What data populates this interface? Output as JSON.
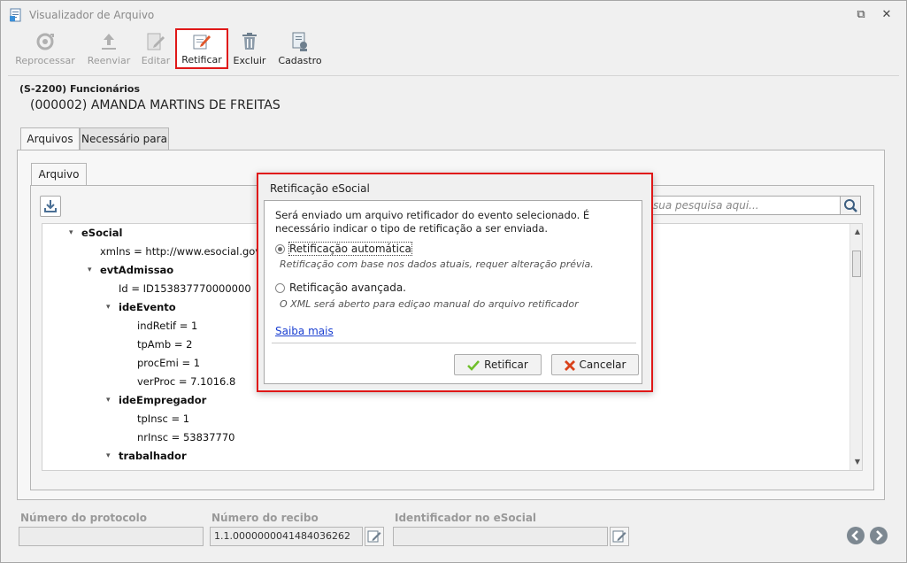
{
  "window": {
    "title": "Visualizador de Arquivo",
    "controls": {
      "restore": "⧉",
      "close": "✕"
    }
  },
  "toolbar": {
    "reprocessar": "Reprocessar",
    "reenviar": "Reenviar",
    "editar": "Editar",
    "retificar": "Retificar",
    "excluir": "Excluir",
    "cadastro": "Cadastro"
  },
  "header": {
    "event_code": "(S-2200) Funcionários",
    "employee": "(000002) AMANDA MARTINS DE FREITAS"
  },
  "tabs": {
    "arquivos": "Arquivos",
    "necessario": "Necessário para",
    "arquivo": "Arquivo"
  },
  "search": {
    "placeholder": "sua pesquisa aqui..."
  },
  "tree": [
    {
      "text": "eSocial",
      "level": 0,
      "bold": true,
      "expanded": true
    },
    {
      "text": "xmlns = http://www.esocial.gov.b",
      "level": 1,
      "bold": false
    },
    {
      "text": "evtAdmissao",
      "level": 1,
      "bold": true,
      "expanded": true
    },
    {
      "text": "Id = ID153837770000000",
      "level": 2,
      "bold": false
    },
    {
      "text": "ideEvento",
      "level": 2,
      "bold": true,
      "expanded": true
    },
    {
      "text": "indRetif = 1",
      "level": 3,
      "bold": false
    },
    {
      "text": "tpAmb = 2",
      "level": 3,
      "bold": false
    },
    {
      "text": "procEmi = 1",
      "level": 3,
      "bold": false
    },
    {
      "text": "verProc = 7.1016.8",
      "level": 3,
      "bold": false
    },
    {
      "text": "ideEmpregador",
      "level": 2,
      "bold": true,
      "expanded": true
    },
    {
      "text": "tpInsc = 1",
      "level": 3,
      "bold": false
    },
    {
      "text": "nrInsc = 53837770",
      "level": 3,
      "bold": false
    },
    {
      "text": "trabalhador",
      "level": 2,
      "bold": true,
      "expanded": true
    }
  ],
  "footer": {
    "protocolo_label": "Número do protocolo",
    "protocolo_value": "",
    "recibo_label": "Número do recibo",
    "recibo_value": "1.1.0000000041484036262",
    "identificador_label": "Identificador no eSocial",
    "identificador_value": ""
  },
  "modal": {
    "title": "Retificação eSocial",
    "message": "Será enviado um arquivo retificador do evento selecionado. É necessário indicar o tipo de retificação a ser enviada.",
    "option_auto_label": "Retificação automática",
    "option_auto_desc": "Retificação com base nos dados atuais, requer alteração prévia.",
    "option_adv_label": "Retificação avançada.",
    "option_adv_desc": "O XML será aberto para ediçao manual do arquivo retificador",
    "link": "Saiba mais",
    "confirm": "Retificar",
    "cancel": "Cancelar",
    "selected": "auto"
  },
  "colors": {
    "highlight": "#e01818",
    "link": "#1a3fd1",
    "confirm_icon": "#6fbf2a",
    "cancel_icon": "#d9421b"
  }
}
